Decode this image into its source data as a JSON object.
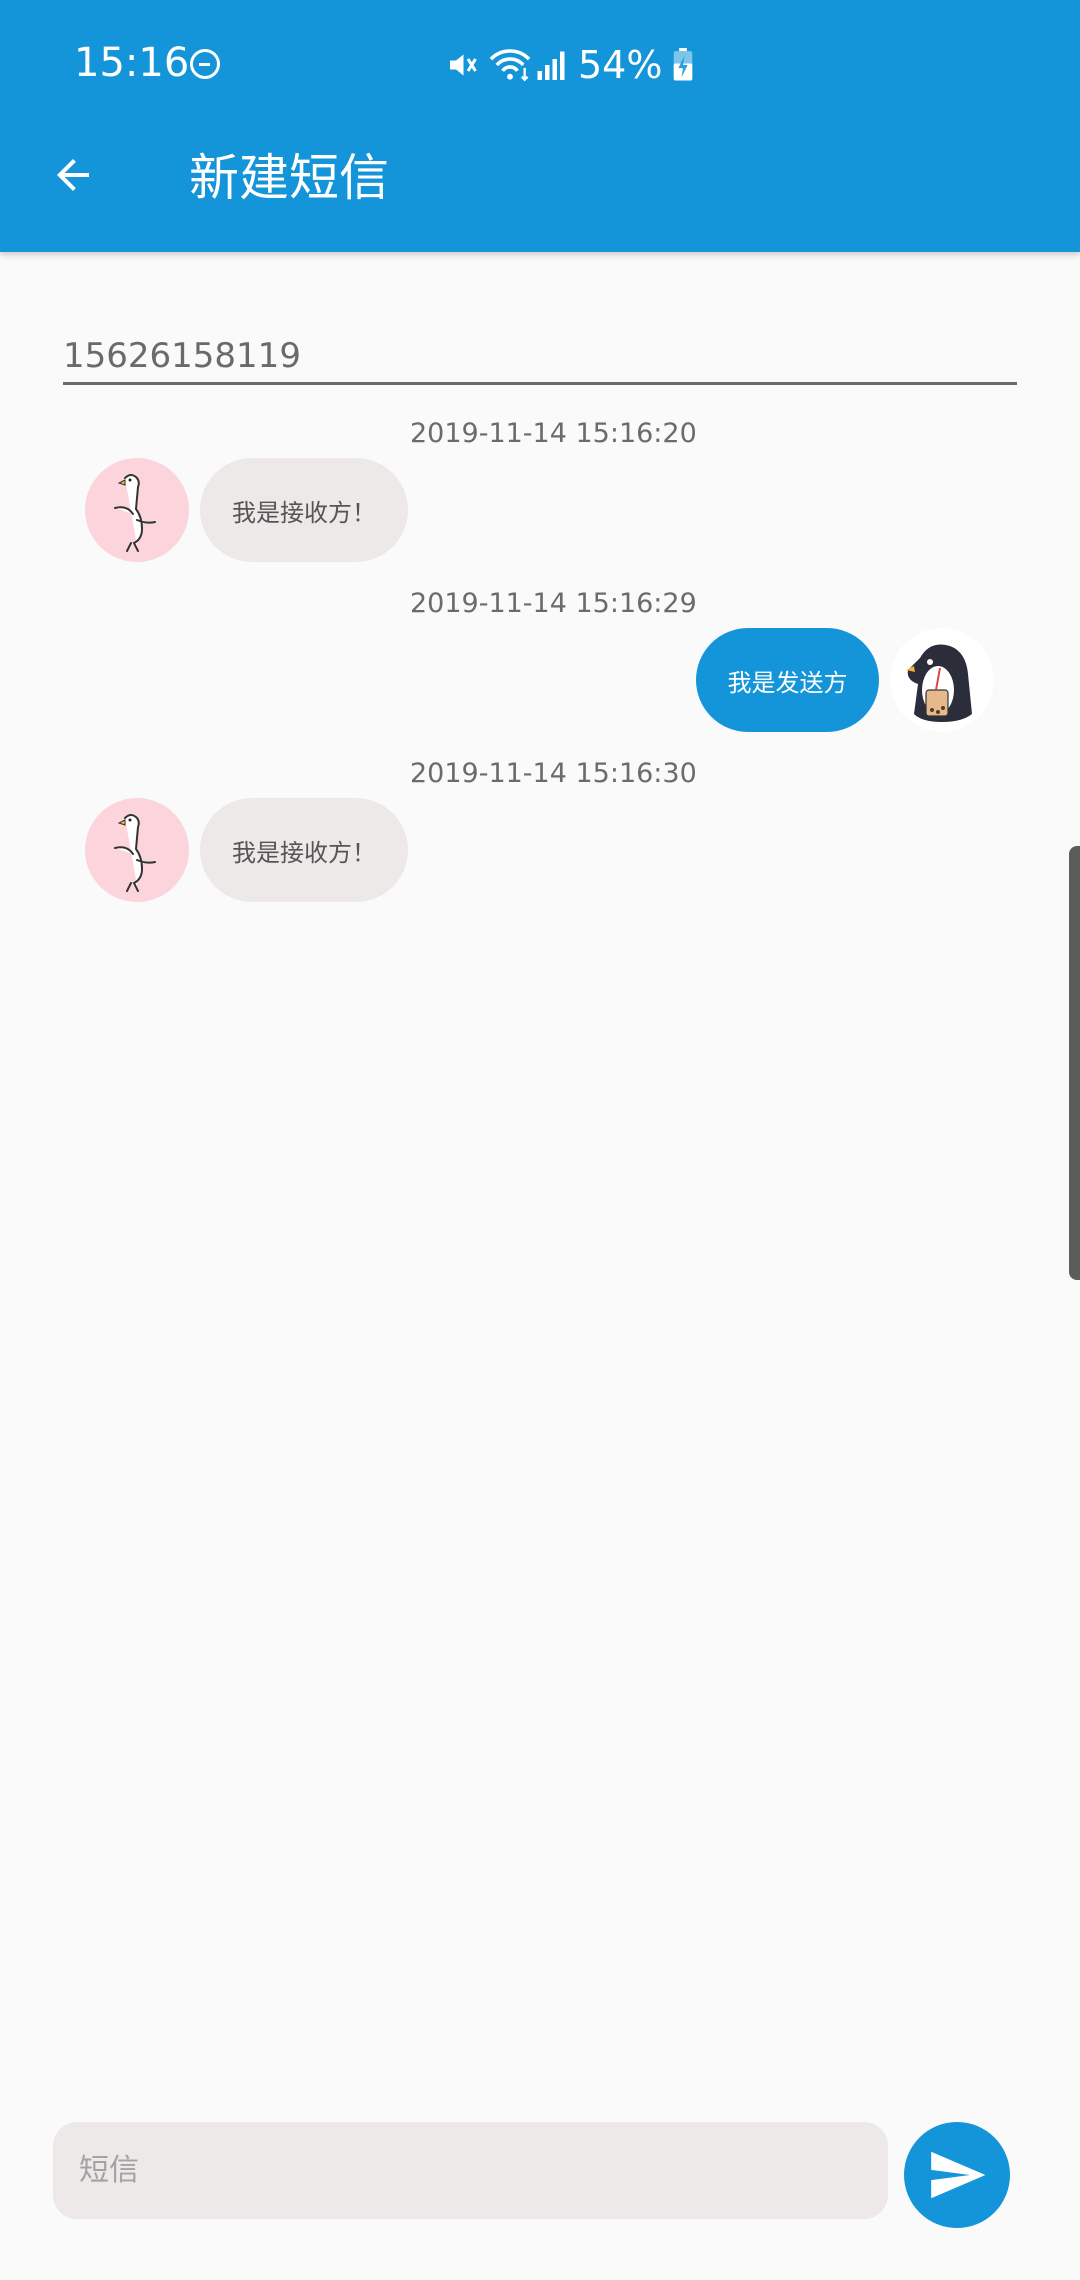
{
  "status_bar": {
    "time": "15:16",
    "battery_percent": "54%"
  },
  "app_bar": {
    "title": "新建短信"
  },
  "recipient": {
    "value": "15626158119"
  },
  "messages": [
    {
      "timestamp": "2019-11-14 15:16:20",
      "text": "我是接收方！",
      "direction": "received"
    },
    {
      "timestamp": "2019-11-14 15:16:29",
      "text": "我是发送方",
      "direction": "sent"
    },
    {
      "timestamp": "2019-11-14 15:16:30",
      "text": "我是接收方！",
      "direction": "received"
    }
  ],
  "composer": {
    "placeholder": "短信"
  },
  "colors": {
    "primary": "#1595d9",
    "received_bubble": "#ece9e8",
    "background": "#fafafa"
  }
}
